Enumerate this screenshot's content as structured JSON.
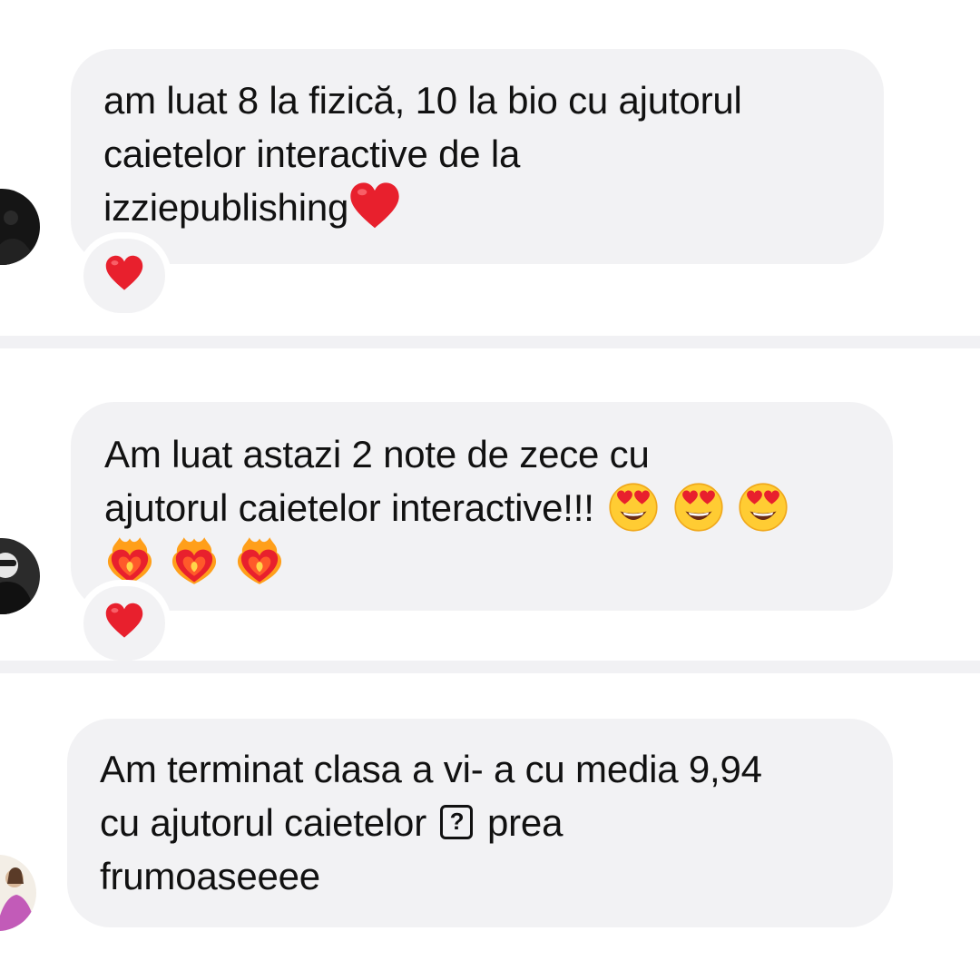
{
  "colors": {
    "bubble_bg": "#f2f2f4",
    "divider": "#f1f1f4",
    "heart": "#e8202d"
  },
  "comments": [
    {
      "avatar_icon": "dark-avatar",
      "lines": [
        "am luat 8 la fizică, 10 la bio cu ajutorul",
        "caietelor interactive de la",
        "izziepublishing"
      ],
      "line_emojis": [
        [],
        [],
        [
          "red-heart"
        ]
      ],
      "reaction_icon": "red-heart"
    },
    {
      "avatar_icon": "dark-avatar",
      "lines": [
        "Am luat astazi 2 note de zece cu",
        "ajutorul caietelor interactive!!!",
        ""
      ],
      "line_emojis": [
        [],
        [
          "heart-eyes-face",
          "heart-eyes-face",
          "heart-eyes-face"
        ],
        [
          "heart-on-fire",
          "heart-on-fire",
          "heart-on-fire"
        ]
      ],
      "reaction_icon": "red-heart"
    },
    {
      "avatar_icon": "photo-avatar",
      "lines": [
        "Am terminat clasa a vi- a cu media 9,94",
        "cu ajutorul caietelor",
        "prea",
        "frumoaseeee"
      ],
      "unknown_glyph": "?"
    }
  ]
}
